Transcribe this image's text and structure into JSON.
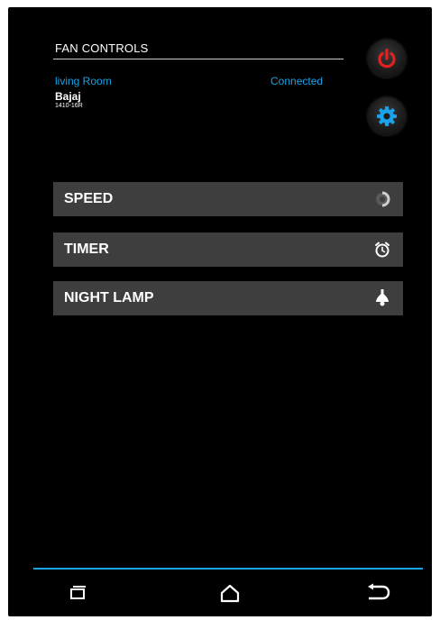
{
  "header": {
    "title": "FAN CONTROLS"
  },
  "device_info": {
    "room": "living Room",
    "status": "Connected",
    "brand": "Bajaj",
    "model": "1410-16R"
  },
  "menu": {
    "items": [
      {
        "label": "SPEED",
        "icon": "speed-dial-icon"
      },
      {
        "label": "TIMER",
        "icon": "alarm-clock-icon"
      },
      {
        "label": "NIGHT LAMP",
        "icon": "lamp-icon"
      }
    ]
  },
  "buttons": {
    "power": {
      "icon": "power-icon",
      "color": "#e52020"
    },
    "settings": {
      "icon": "gear-icon",
      "color": "#1aa3e6"
    }
  },
  "nav": {
    "items": [
      "recent-apps-icon",
      "home-icon",
      "back-icon"
    ]
  },
  "colors": {
    "accent": "#1aa3e6",
    "background": "#000000",
    "row": "#3e3e3e"
  }
}
